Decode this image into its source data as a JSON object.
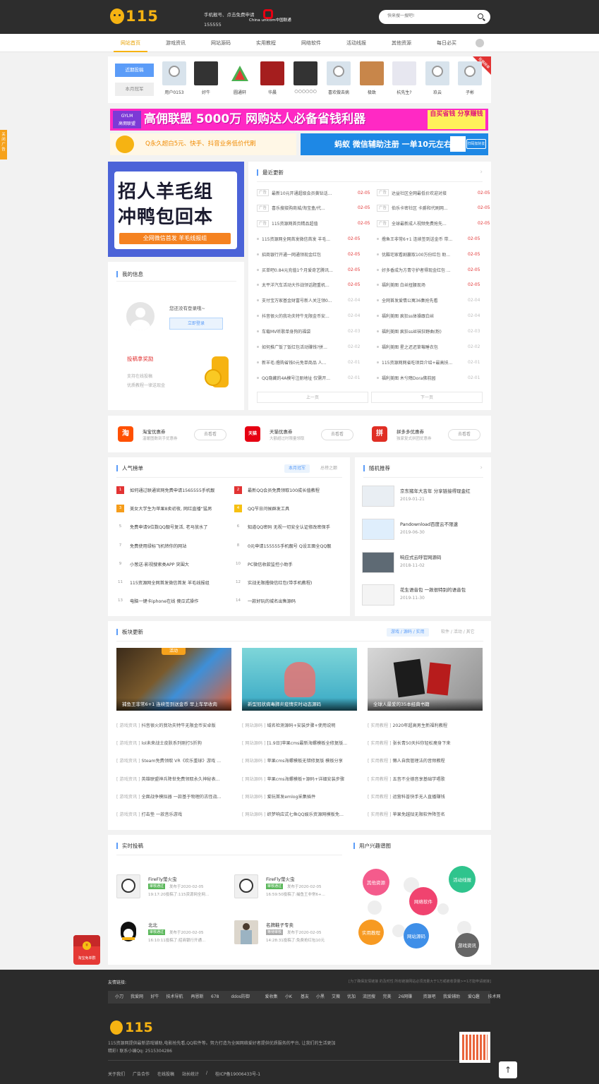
{
  "header": {
    "logo_text": "115",
    "phone_line1": "手机靓号、点击免费申请",
    "phone_line2": "155555",
    "unicom_text": "China unicom中国联通",
    "search_placeholder": "快来搜一搜吧!"
  },
  "nav": [
    "网站首页",
    "游戏资讯",
    "网站源码",
    "实用教程",
    "网络软件",
    "活动线报",
    "其他资源",
    "每日必买"
  ],
  "users": {
    "tab_active": "近期投稿",
    "tab_inactive": "本月冠军",
    "badge": "投稿榜单",
    "list": [
      "用户0153",
      "好牛",
      "圆通轩",
      "华晨",
      "○○○○○○",
      "喜欢做去病",
      "极致",
      "杭先生?",
      "玖云",
      "子彬"
    ]
  },
  "banners": {
    "gylm_logo": "GYLM",
    "gylm_logo_sub": "高佣联盟",
    "gylm_text": "高佣联盟 5000万 网购达人必备省钱利器",
    "gylm_right": "自买省钱 分享赚钱",
    "duck_text": "Q永久超白5元、快手、抖音业务低价代刷",
    "ant_text": "蚂蚁 微信辅助注册 一单10元左右",
    "ant_btn": "扫码加好友"
  },
  "bigad": {
    "line1": "招人羊毛组",
    "line2": "冲鸭包回本",
    "line3": "全网微信首发 羊毛线报组"
  },
  "myinfo": {
    "title": "我的信息",
    "login_text": "您还没有登录哦~",
    "login_btn": "立即登录",
    "reward_title": "投稿拿奖励",
    "reward_sub1": "支持在线投稿",
    "reward_sub2": "优质教程一律送现金"
  },
  "recent": {
    "title": "最近更新",
    "prev": "上一页",
    "next": "下一页",
    "left": [
      {
        "tag": "广告",
        "title": "最新10元开通超级会员黄钻话...",
        "date": "02-05",
        "red": true
      },
      {
        "tag": "广告",
        "title": "喜乐搜接购商城/淘宝盒/代...",
        "date": "02-05",
        "red": true
      },
      {
        "tag": "广告",
        "title": "115资源网首页精品超值",
        "date": "02-05",
        "red": true
      },
      {
        "tag": "",
        "title": "115资源网全网首发微信首发 羊毛...",
        "date": "02-05",
        "red": true
      },
      {
        "tag": "",
        "title": "招商银行开通一网通领现金红包",
        "date": "02-05",
        "red": true
      },
      {
        "tag": "",
        "title": "买单吧0.84元充值1个月爱奇艺腾讯...",
        "date": "02-05",
        "red": true
      },
      {
        "tag": "",
        "title": "太平洋汽车活动大作战领话题重机...",
        "date": "02-05",
        "red": true
      },
      {
        "tag": "",
        "title": "支付宝万家基金财富号新人关注领0...",
        "date": "02-04",
        "red": false
      },
      {
        "tag": "",
        "title": "抖音很火的我功夫特牛无限金币安...",
        "date": "02-04",
        "red": false
      },
      {
        "tag": "",
        "title": "车载MV听歌单身狗的福袋",
        "date": "02-03",
        "red": false
      },
      {
        "tag": "",
        "title": "如何推广饭了饭红包活动赚钱?拼...",
        "date": "02-02",
        "red": false
      },
      {
        "tag": "",
        "title": "新羊毛:撸购省钱0元免单商品 人...",
        "date": "02-01",
        "red": false
      },
      {
        "tag": "",
        "title": "QQ隐藏的4A模号注册地址 仅需开...",
        "date": "02-01",
        "red": false
      }
    ],
    "right": [
      {
        "tag": "广告",
        "title": "达益社区全网最低价欢迎对接",
        "date": "02-05",
        "red": true
      },
      {
        "tag": "广告",
        "title": "伯乐卡密社区 卡爵和代刷网...",
        "date": "02-05",
        "red": true
      },
      {
        "tag": "广告",
        "title": "全球最新成人视频免费抢先...",
        "date": "02-05",
        "red": true
      },
      {
        "tag": "",
        "title": "撸鱼王非常6+1 连续签到送金币 带...",
        "date": "02-05",
        "red": true
      },
      {
        "tag": "",
        "title": "优酷宅家看剧赢取100万份红包 助...",
        "date": "02-05",
        "red": true
      },
      {
        "tag": "",
        "title": "好多香成为方青守护者得现金红包 ...",
        "date": "02-05",
        "red": true
      },
      {
        "tag": "",
        "title": "福利美图 白丝扭腰现场",
        "date": "02-05",
        "red": true
      },
      {
        "tag": "",
        "title": "全网首发爱情公寓36集抢先看",
        "date": "02-04",
        "red": false
      },
      {
        "tag": "",
        "title": "福利美图 疯狂ss体操跟白丝",
        "date": "02-04",
        "red": false
      },
      {
        "tag": "",
        "title": "福利美图 疯狂ss丝袜狂野曲(粉)",
        "date": "02-03",
        "red": false
      },
      {
        "tag": "",
        "title": "福利美图 星之迟迟草莓睡衣包",
        "date": "02-02",
        "red": false
      },
      {
        "tag": "",
        "title": "115资源网网省吃项目介绍+最高扶...",
        "date": "02-01",
        "red": false
      },
      {
        "tag": "",
        "title": "福利美图 木兮隋Dora佛前园",
        "date": "02-01",
        "red": false
      }
    ]
  },
  "coupons": [
    {
      "icon": "淘",
      "name": "淘宝优惠券",
      "desc": "温暖图数到手优惠券",
      "btn": "去看看",
      "color": "#ff5000"
    },
    {
      "icon": "天猫",
      "name": "天猫优惠券",
      "desc": "大额超过时限量领取",
      "btn": "去看看",
      "color": "#e60012"
    },
    {
      "icon": "拼",
      "name": "拼多多优惠券",
      "desc": "独家复式拼团优惠券",
      "btn": "去看看",
      "color": "#e02e24"
    }
  ],
  "hot": {
    "title": "人气榜单",
    "tab1": "本月冠军",
    "tab2": "总榜之巅",
    "items": [
      [
        "1",
        "如何通过联通官网免费申请1565555手机靓"
      ],
      [
        "2",
        "最新QQ会员免费领取100成长值教程"
      ],
      [
        "3",
        "美女大学生为苹果8卖初夜, 网红直播“猛男"
      ],
      [
        "4",
        "QQ节日问候群发工具"
      ],
      [
        "5",
        "免费申请9位数QQ靓号复活, 老马放水了"
      ],
      [
        "6",
        "知道QQ密码 无视一切安全认证修改密保手"
      ],
      [
        "7",
        "免费使用绿标飞机转你的网站"
      ],
      [
        "8",
        "0元申请155555手机靓号 Q设王面全QQ靓"
      ],
      [
        "9",
        "小葱送-影视搜索类APP 突围大"
      ],
      [
        "10",
        "PC微信收款监控小助手"
      ],
      [
        "11",
        "115资源网全网首发微信首发 羊毛线报组"
      ],
      [
        "12",
        "实战无限撸微信红包(带手机教程)"
      ],
      [
        "13",
        "电脑一键卡iphone在线 傻瓜式操作"
      ],
      [
        "14",
        "一款好玩的城名出售源码"
      ]
    ]
  },
  "random": {
    "title": "随机推荐",
    "items": [
      {
        "t": "京东猪年大吉年 分享链接得现金红",
        "d": "2019-01-21"
      },
      {
        "t": "Pandownload百度云不限速",
        "d": "2019-06-30"
      },
      {
        "t": "响应式云呼官网源码",
        "d": "2018-11-02"
      },
      {
        "t": "花生语音包 一款很特别的语音包",
        "d": "2019-11-30"
      }
    ]
  },
  "blocks": {
    "title": "板块更新",
    "tabs_active": "游戏 / 源码 / 实用",
    "tabs_other": "软件 / 活动 / 其它",
    "images": [
      {
        "cap": "捕鱼王非常6+1 连续签到送金币 早上车早收肉",
        "label": "活动"
      },
      {
        "cap": "新型冠状病毒肺炎疫情实时动态源码"
      },
      {
        "cap": "全球人最爱的35本经典书籍"
      }
    ],
    "cols": [
      [
        [
          "[ 游戏资讯 ]",
          "抖音很火的我功夫特牛无限金币安卓版"
        ],
        [
          "[ 游戏资讯 ]",
          "lol未来战士皮肤系列刚打5折狗"
        ],
        [
          "[ 游戏资讯 ]",
          "Steam免费领取 VR《欢乐重球》游戏 ..."
        ],
        [
          "[ 游戏资讯 ]",
          "英雄联盟神兵降世免费领取永久神秘表..."
        ],
        [
          "[ 游戏资讯 ]",
          "全面战争模拟器 一款基于物理的古怪战..."
        ],
        [
          "[ 游戏资讯 ]",
          "打击垫 一款音乐游戏"
        ]
      ],
      [
        [
          "[ 网站源码 ]",
          "域名检测源码+安装步骤+使用说明"
        ],
        [
          "[ 网站源码 ]",
          "[1.9日]苹果cms最新海螺模板全修复版..."
        ],
        [
          "[ 网站源码 ]",
          "苹果cms海螺模板无错修复版 模板分享"
        ],
        [
          "[ 网站源码 ]",
          "苹果cms海螺模板+源码+详细安装步骤"
        ],
        [
          "[ 网站源码 ]",
          "爱玩首发emlog采集插件"
        ],
        [
          "[ 网站源码 ]",
          "织梦响应式七鱼QQ娱乐资源网模板免..."
        ]
      ],
      [
        [
          "[ 实用教程 ]",
          "2020年超高男生新福利教程"
        ],
        [
          "[ 实用教程 ]",
          "张长青50天抖你轻松瘦身下来"
        ],
        [
          "[ 实用教程 ]",
          "懒人自我管理法的音频教程"
        ],
        [
          "[ 实用教程 ]",
          "五音不全德音享基础学唱歌"
        ],
        [
          "[ 实用教程 ]",
          "运营科普快手无人直播赚钱"
        ],
        [
          "[ 实用教程 ]",
          "苹果免越狱无限软件降签名"
        ]
      ]
    ]
  },
  "posts": {
    "title": "实时投稿",
    "items": [
      {
        "name": "FireFly萤火虫",
        "status": "审核通过",
        "time": "发布于2020-02-05",
        "content": "19:17:20投稿了:115资源网全网..."
      },
      {
        "name": "FireFly萤火虫",
        "status": "审核通过",
        "time": "发布于2020-02-05",
        "content": "16:59:50投稿了:捕鱼王非常6+..."
      },
      {
        "name": "北北",
        "status": "审核通过",
        "time": "发布于2020-02-05",
        "content": "16:10:11投稿了:招商银行开通..."
      },
      {
        "name": "名牌鞋子专卖",
        "status": "等待审核",
        "time": "发布于2020-02-05",
        "content": "14:28:31投稿了:免费抢红包10元"
      }
    ]
  },
  "interest": {
    "title": "用户兴趣谱图",
    "bubbles": [
      "其他资源",
      "活动线报",
      "网络软件",
      "实用教程",
      "网站源码",
      "游戏资讯"
    ]
  },
  "footer": {
    "links_label": "友情链接:",
    "links_note": "[为了确保友情链接 的及时性 所有链接网站必须流量大于1万或被收录量>=1才能申请链接]",
    "links": [
      "小刀",
      "我爱网",
      "好牛",
      "技术导航",
      "再恩斯",
      "678",
      "ddos防御",
      "爱收集",
      "小K",
      "基友",
      "小黑",
      "艾薇",
      "优加",
      "流团搜",
      "完美",
      "26网赚",
      "资源吧",
      "我爱辅助",
      "爱Q趣",
      "技术网"
    ],
    "desc": "115资源网提供最新游戏辅助,电影抢先看,QQ软件等。努力打造为全国网络爱好者提供优质服务的平台, 让我们的生活更加精彩!   联系小编Qq: 2515304286",
    "bottom": [
      "关于我们",
      "广告合作",
      "在线投稿",
      "站长统计",
      "/",
      "桂ICP备19006433号-1"
    ],
    "side_tab": "关闭广告",
    "redpack_label": "淘宝免单群"
  }
}
